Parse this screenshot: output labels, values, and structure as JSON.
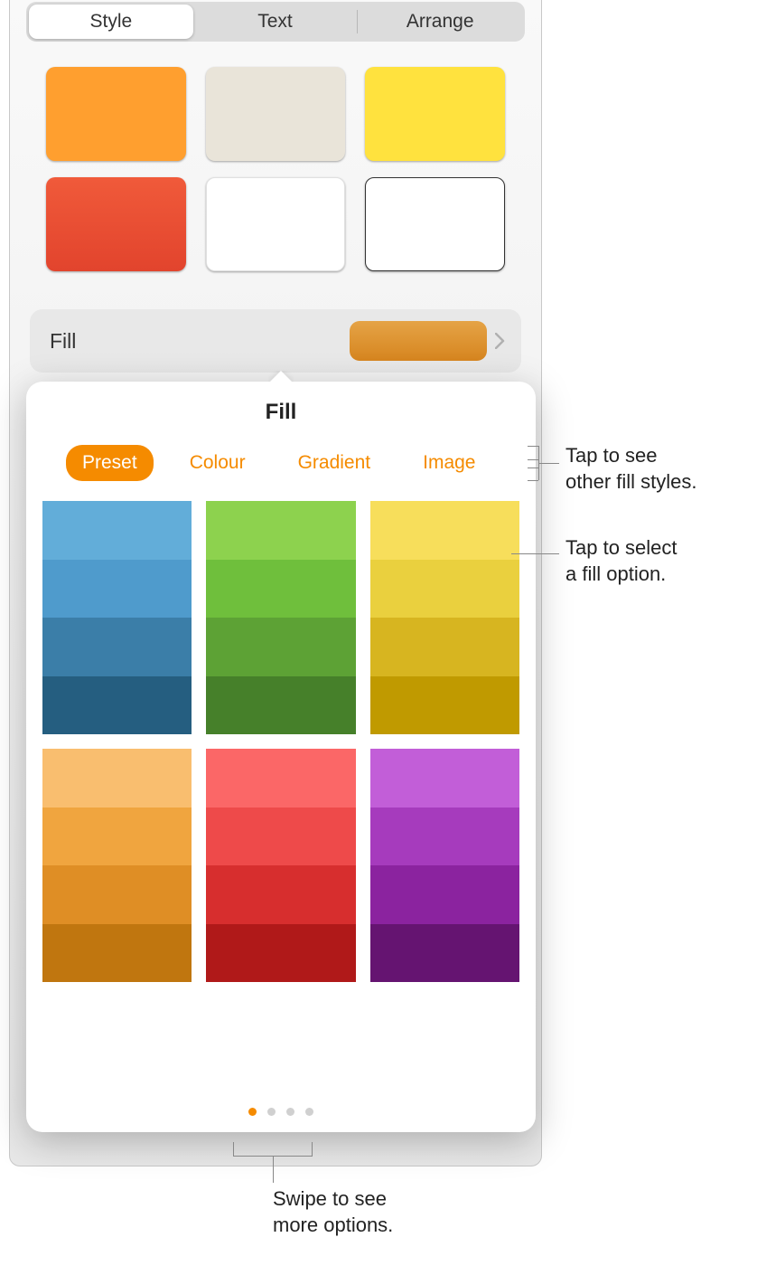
{
  "tabs": {
    "style": "Style",
    "text": "Text",
    "arrange": "Arrange"
  },
  "styleSwatches": [
    {
      "bg": "#ff9f2f"
    },
    {
      "bg": "#e9e4d9"
    },
    {
      "bg": "#ffe23e"
    },
    {
      "bg": "linear-gradient(#f05a3a,#e2442d)"
    },
    {
      "bg": "#ffffff",
      "border": "0"
    },
    {
      "bg": "#ffffff",
      "border": "1"
    }
  ],
  "fillRow": {
    "label": "Fill"
  },
  "popover": {
    "title": "Fill"
  },
  "fillTabs": {
    "preset": "Preset",
    "colour": "Colour",
    "gradient": "Gradient",
    "image": "Image"
  },
  "presets": [
    [
      "#62add9",
      "#4f9bcc",
      "#3b7ea8",
      "#255e80"
    ],
    [
      "#8dd24e",
      "#6fbf3c",
      "#5da235",
      "#46802a"
    ],
    [
      "#f7de5b",
      "#ead03e",
      "#d7b520",
      "#c09a00"
    ],
    [
      "#f9be6f",
      "#f0a53f",
      "#df8e25",
      "#c0760f"
    ],
    [
      "#fb6767",
      "#ee4a4a",
      "#d72e2e",
      "#b01919"
    ],
    [
      "#c25ed8",
      "#a63bbd",
      "#8b239f",
      "#651471"
    ]
  ],
  "callouts": {
    "tabsLine1": "Tap to see",
    "tabsLine2": "other fill styles.",
    "optionLine1": "Tap to select",
    "optionLine2": "a fill option.",
    "swipeLine1": "Swipe to see",
    "swipeLine2": "more options."
  }
}
